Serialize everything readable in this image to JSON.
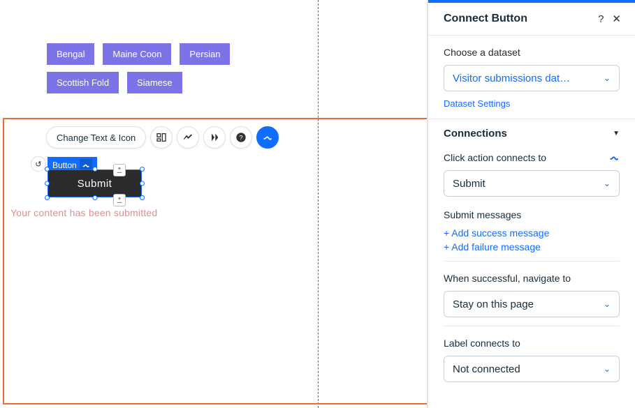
{
  "tags": [
    "Bengal",
    "Maine Coon",
    "Persian",
    "Scottish Fold",
    "Siamese"
  ],
  "toolbar": {
    "change_text_icon": "Change Text & Icon"
  },
  "element": {
    "tag_label": "Button",
    "submit_label": "Submit",
    "status_message": "Your content has been submitted"
  },
  "panel": {
    "title": "Connect Button",
    "dataset": {
      "label": "Choose a dataset",
      "value": "Visitor submissions dat…",
      "settings_link": "Dataset Settings"
    },
    "connections": {
      "heading": "Connections",
      "click_action": {
        "label": "Click action connects to",
        "value": "Submit"
      },
      "submit_messages": {
        "label": "Submit messages",
        "add_success": "+ Add success message",
        "add_failure": "+ Add failure message"
      },
      "navigate": {
        "label": "When successful, navigate to",
        "value": "Stay on this page"
      },
      "label_connects": {
        "label": "Label connects to",
        "value": "Not connected"
      }
    }
  }
}
